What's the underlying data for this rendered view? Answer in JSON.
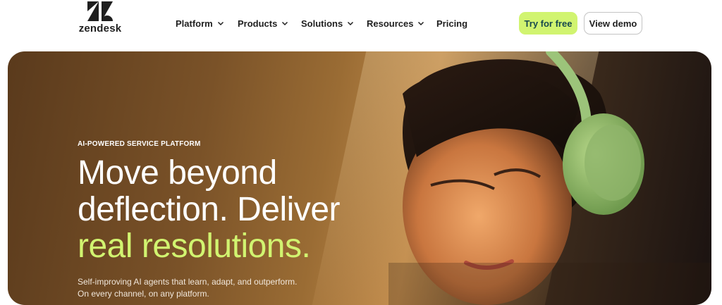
{
  "brand": {
    "logo_text": "zendesk"
  },
  "nav": [
    {
      "label": "Platform",
      "has_dropdown": true
    },
    {
      "label": "Products",
      "has_dropdown": true
    },
    {
      "label": "Solutions",
      "has_dropdown": true
    },
    {
      "label": "Resources",
      "has_dropdown": true
    },
    {
      "label": "Pricing",
      "has_dropdown": false
    }
  ],
  "actions": {
    "primary_label": "Try for free",
    "secondary_label": "View demo"
  },
  "hero": {
    "eyebrow": "AI-POWERED SERVICE PLATFORM",
    "headline_line1": "Move beyond",
    "headline_line2": "deflection. Deliver",
    "headline_accent": "real resolutions.",
    "subtext_line1": "Self-improving AI agents that learn, adapt, and outperform.",
    "subtext_line2": "On every channel, on any platform."
  },
  "colors": {
    "accent": "#d1f470",
    "primary_button_text": "#17494d",
    "text_dark": "#1f1f1f"
  }
}
